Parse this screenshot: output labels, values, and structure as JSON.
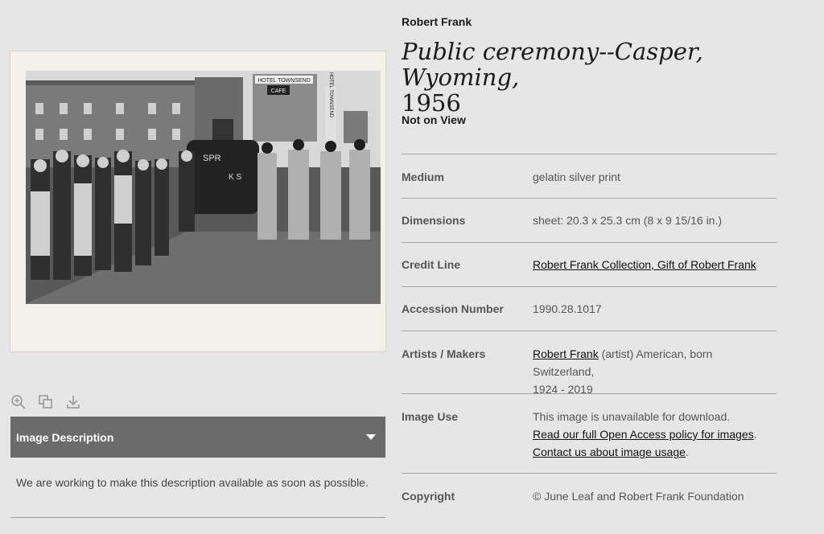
{
  "artist": "Robert Frank",
  "title": {
    "line1": "Public ceremony--Casper, Wyoming,",
    "line2": "1956"
  },
  "status": "Not on View",
  "photo_signage": {
    "hotel_sign": "HOTEL TOWNSEND",
    "cafe_sign": "CAFE",
    "vertical_sign": "HOTEL TOWNSEND",
    "van_text": "SPR",
    "van_letters": "K S"
  },
  "tools": [
    {
      "name": "zoom-icon"
    },
    {
      "name": "compare-icon"
    },
    {
      "name": "download-icon"
    }
  ],
  "image_description": {
    "label": "Image Description",
    "body": "We are working to make this description available as soon as possible."
  },
  "details": {
    "medium": {
      "label": "Medium",
      "value": "gelatin silver print"
    },
    "dimensions": {
      "label": "Dimensions",
      "value": "sheet: 20.3 x 25.3 cm (8 x 9 15/16 in.)"
    },
    "credit": {
      "label": "Credit Line",
      "value": "Robert Frank Collection, Gift of Robert Frank"
    },
    "accession": {
      "label": "Accession Number",
      "value": "1990.28.1017"
    },
    "artists": {
      "label": "Artists / Makers",
      "link": "Robert Frank",
      "role": " (artist) American, born Switzerland,",
      "dates": "1924 - 2019"
    },
    "image_use": {
      "label": "Image Use",
      "line1": "This image is unavailable for download.",
      "link1": "Read our full Open Access policy for images",
      "link2": "Contact us about image usage",
      "punct": "."
    },
    "copyright": {
      "label": "Copyright",
      "value": "© June Leaf and Robert Frank Foundation"
    }
  },
  "colors": {
    "accent_bar": "#6b6b6b",
    "background": "#e6e6e6",
    "divider": "#a5a5a5"
  }
}
